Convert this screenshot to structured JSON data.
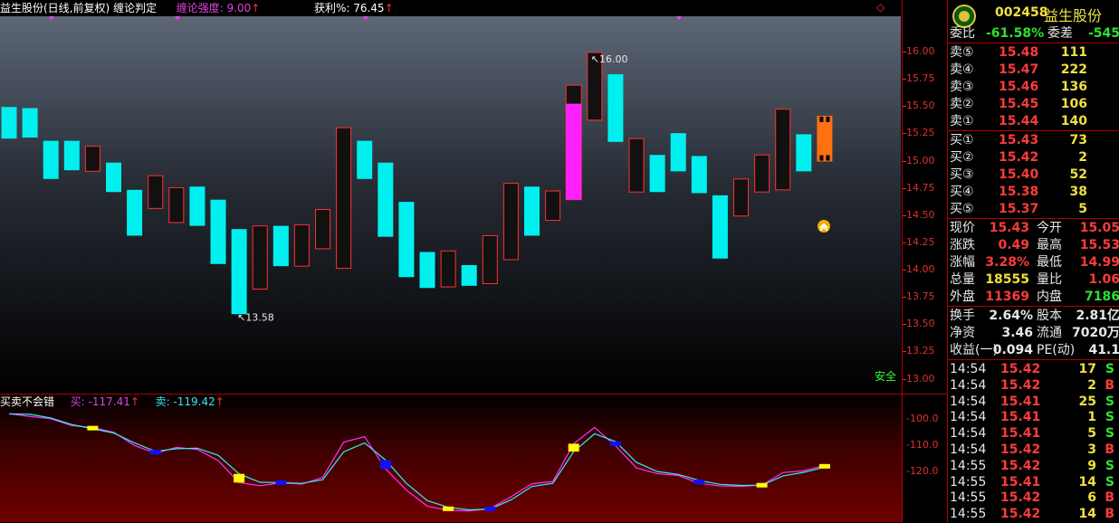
{
  "main_header": {
    "title": "益生股份(日线,前复权) 缠论判定",
    "strength": "缠论强度: 9.00",
    "profit": "获利%: 76.45",
    "up_arrow": "↑",
    "corner_marker": "◇"
  },
  "price_axis": [
    "16.00",
    "15.75",
    "15.50",
    "15.25",
    "15.00",
    "14.75",
    "14.50",
    "14.25",
    "14.00",
    "13.75",
    "13.50",
    "13.25",
    "13.00"
  ],
  "annotations": {
    "high": "16.00",
    "low": "13.58",
    "safe": "安全"
  },
  "chart_data": {
    "type": "candlestick",
    "ylim": [
      13.0,
      16.0
    ],
    "candles": [
      {
        "open": 15.5,
        "close": 15.21,
        "color": "cyan"
      },
      {
        "open": 15.49,
        "close": 15.22,
        "color": "cyan"
      },
      {
        "open": 15.19,
        "close": 14.84,
        "color": "cyan"
      },
      {
        "open": 15.19,
        "close": 14.92,
        "color": "cyan"
      },
      {
        "open": 14.91,
        "close": 15.14,
        "color": "red"
      },
      {
        "open": 14.99,
        "close": 14.72,
        "color": "cyan"
      },
      {
        "open": 14.74,
        "close": 14.32,
        "color": "cyan"
      },
      {
        "open": 14.57,
        "close": 14.87,
        "color": "red"
      },
      {
        "open": 14.44,
        "close": 14.76,
        "color": "red"
      },
      {
        "open": 14.77,
        "close": 14.41,
        "color": "cyan"
      },
      {
        "open": 14.65,
        "close": 14.06,
        "color": "cyan"
      },
      {
        "open": 14.38,
        "close": 13.6,
        "color": "cyan"
      },
      {
        "open": 13.83,
        "close": 14.41,
        "color": "red"
      },
      {
        "open": 14.41,
        "close": 14.04,
        "color": "cyan"
      },
      {
        "open": 14.04,
        "close": 14.42,
        "color": "red"
      },
      {
        "open": 14.2,
        "close": 14.56,
        "color": "red"
      },
      {
        "open": 14.02,
        "close": 15.31,
        "color": "red"
      },
      {
        "open": 15.19,
        "close": 14.84,
        "color": "cyan"
      },
      {
        "open": 14.99,
        "close": 14.31,
        "color": "cyan"
      },
      {
        "open": 14.63,
        "close": 13.94,
        "color": "cyan"
      },
      {
        "open": 14.17,
        "close": 13.84,
        "color": "cyan"
      },
      {
        "open": 13.85,
        "close": 14.18,
        "color": "red"
      },
      {
        "open": 14.05,
        "close": 13.86,
        "color": "cyan"
      },
      {
        "open": 13.88,
        "close": 14.32,
        "color": "red"
      },
      {
        "open": 14.1,
        "close": 14.8,
        "color": "red"
      },
      {
        "open": 14.77,
        "close": 14.32,
        "color": "cyan"
      },
      {
        "open": 14.46,
        "close": 14.73,
        "color": "red"
      },
      {
        "open": 14.65,
        "close": 15.53,
        "color": "magenta"
      },
      {
        "open": 15.38,
        "close": 16.0,
        "color": "red"
      },
      {
        "open": 15.8,
        "close": 15.18,
        "color": "cyan"
      },
      {
        "open": 14.72,
        "close": 15.21,
        "color": "red"
      },
      {
        "open": 15.06,
        "close": 14.72,
        "color": "cyan"
      },
      {
        "open": 15.26,
        "close": 14.91,
        "color": "cyan"
      },
      {
        "open": 15.05,
        "close": 14.71,
        "color": "cyan"
      },
      {
        "open": 14.69,
        "close": 14.11,
        "color": "cyan"
      },
      {
        "open": 14.5,
        "close": 14.84,
        "color": "red"
      },
      {
        "open": 14.72,
        "close": 15.06,
        "color": "red"
      },
      {
        "open": 14.74,
        "close": 15.48,
        "color": "red"
      },
      {
        "open": 15.25,
        "close": 14.91,
        "color": "cyan"
      },
      {
        "open": 15.42,
        "close": 15.0,
        "color": "orange"
      }
    ]
  },
  "sub_header": {
    "name": "买卖不会错",
    "buy": "买: -117.41",
    "sell": "卖: -119.42",
    "up_arrow": "↑"
  },
  "sub_axis": [
    "-100.0",
    "-110.0",
    "-120.0"
  ],
  "sub_chart": {
    "type": "line",
    "ylim": [
      -135,
      -95
    ],
    "buy": [
      -97.7,
      -98.7,
      -99.6,
      -102.2,
      -102.9,
      -104.7,
      -109.8,
      -112.7,
      -110.5,
      -111.3,
      -115.5,
      -123.9,
      -125.1,
      -124.0,
      -124.5,
      -121.9,
      -108.5,
      -106.4,
      -118.6,
      -126.8,
      -132.9,
      -134.5,
      -134.7,
      -133.8,
      -129.3,
      -124.4,
      -123.5,
      -109.1,
      -102.9,
      -109.9,
      -118.3,
      -120.5,
      -121.2,
      -124.2,
      -125.2,
      -125.3,
      -124.9,
      -120.1,
      -119.4,
      -117.4
    ],
    "sell": [
      -97.7,
      -97.9,
      -99.3,
      -101.8,
      -103.4,
      -105.0,
      -108.8,
      -112.0,
      -111.0,
      -110.8,
      -113.5,
      -120.6,
      -123.8,
      -123.9,
      -124.2,
      -122.8,
      -112.2,
      -108.8,
      -115.3,
      -124.2,
      -130.8,
      -133.3,
      -134.3,
      -134.0,
      -130.5,
      -125.4,
      -124.2,
      -112.1,
      -105.3,
      -108.3,
      -116.2,
      -119.7,
      -120.8,
      -123.1,
      -124.6,
      -125.0,
      -124.9,
      -121.4,
      -120.0,
      -118.0
    ],
    "bars": [
      {
        "i": 4,
        "c": "yellow"
      },
      {
        "i": 7,
        "c": "blue"
      },
      {
        "i": 11,
        "c": "yellow"
      },
      {
        "i": 13,
        "c": "blue"
      },
      {
        "i": 18,
        "c": "blue"
      },
      {
        "i": 21,
        "c": "yellow"
      },
      {
        "i": 23,
        "c": "blue"
      },
      {
        "i": 27,
        "c": "yellow"
      },
      {
        "i": 29,
        "c": "blue"
      },
      {
        "i": 33,
        "c": "blue"
      },
      {
        "i": 36,
        "c": "yellow"
      },
      {
        "i": 39,
        "c": "yellow"
      }
    ]
  },
  "quote": {
    "code": "002458",
    "name": "益生股份",
    "wb_label": "委比",
    "wb_value": "-61.58%",
    "wc_label": "委差",
    "wc_value": "-545",
    "sells": [
      {
        "label": "卖⑤",
        "price": "15.48",
        "vol": "111"
      },
      {
        "label": "卖④",
        "price": "15.47",
        "vol": "222"
      },
      {
        "label": "卖③",
        "price": "15.46",
        "vol": "136"
      },
      {
        "label": "卖②",
        "price": "15.45",
        "vol": "106"
      },
      {
        "label": "卖①",
        "price": "15.44",
        "vol": "140"
      }
    ],
    "buys": [
      {
        "label": "买①",
        "price": "15.43",
        "vol": "73"
      },
      {
        "label": "买②",
        "price": "15.42",
        "vol": "2"
      },
      {
        "label": "买③",
        "price": "15.40",
        "vol": "52"
      },
      {
        "label": "买④",
        "price": "15.38",
        "vol": "38"
      },
      {
        "label": "买⑤",
        "price": "15.37",
        "vol": "5"
      }
    ],
    "stats": [
      {
        "l1": "现价",
        "v1": "15.43",
        "c1": "red",
        "l2": "今开",
        "v2": "15.05",
        "c2": "red"
      },
      {
        "l1": "涨跌",
        "v1": "0.49",
        "c1": "red",
        "l2": "最高",
        "v2": "15.53",
        "c2": "red"
      },
      {
        "l1": "涨幅",
        "v1": "3.28%",
        "c1": "red",
        "l2": "最低",
        "v2": "14.99",
        "c2": "red"
      },
      {
        "l1": "总量",
        "v1": "18555",
        "c1": "yellow",
        "l2": "量比",
        "v2": "1.06",
        "c2": "red"
      },
      {
        "l1": "外盘",
        "v1": "11369",
        "c1": "red",
        "l2": "内盘",
        "v2": "7186",
        "c2": "green"
      }
    ],
    "stats2": [
      {
        "l1": "换手",
        "v1": "2.64%",
        "l2": "股本",
        "v2": "2.81亿"
      },
      {
        "l1": "净资",
        "v1": "3.46",
        "l2": "流通",
        "v2": "7020万"
      },
      {
        "l1": "收益(一)",
        "v1": "0.094",
        "l2": "PE(动)",
        "v2": "41.1"
      }
    ],
    "ticks": [
      {
        "time": "14:54",
        "price": "15.42",
        "vol": "17",
        "side": "S",
        "pc": "red"
      },
      {
        "time": "14:54",
        "price": "15.42",
        "vol": "2",
        "side": "B",
        "pc": "red"
      },
      {
        "time": "14:54",
        "price": "15.41",
        "vol": "25",
        "side": "S",
        "pc": "red"
      },
      {
        "time": "14:54",
        "price": "15.41",
        "vol": "1",
        "side": "S",
        "pc": "red"
      },
      {
        "time": "14:54",
        "price": "15.41",
        "vol": "5",
        "side": "S",
        "pc": "red"
      },
      {
        "time": "14:54",
        "price": "15.42",
        "vol": "3",
        "side": "B",
        "pc": "red"
      },
      {
        "time": "14:55",
        "price": "15.42",
        "vol": "9",
        "side": "S",
        "pc": "red"
      },
      {
        "time": "14:55",
        "price": "15.41",
        "vol": "14",
        "side": "S",
        "pc": "red"
      },
      {
        "time": "14:55",
        "price": "15.42",
        "vol": "6",
        "side": "B",
        "pc": "red"
      },
      {
        "time": "14:55",
        "price": "15.42",
        "vol": "14",
        "side": "B",
        "pc": "red"
      }
    ]
  }
}
